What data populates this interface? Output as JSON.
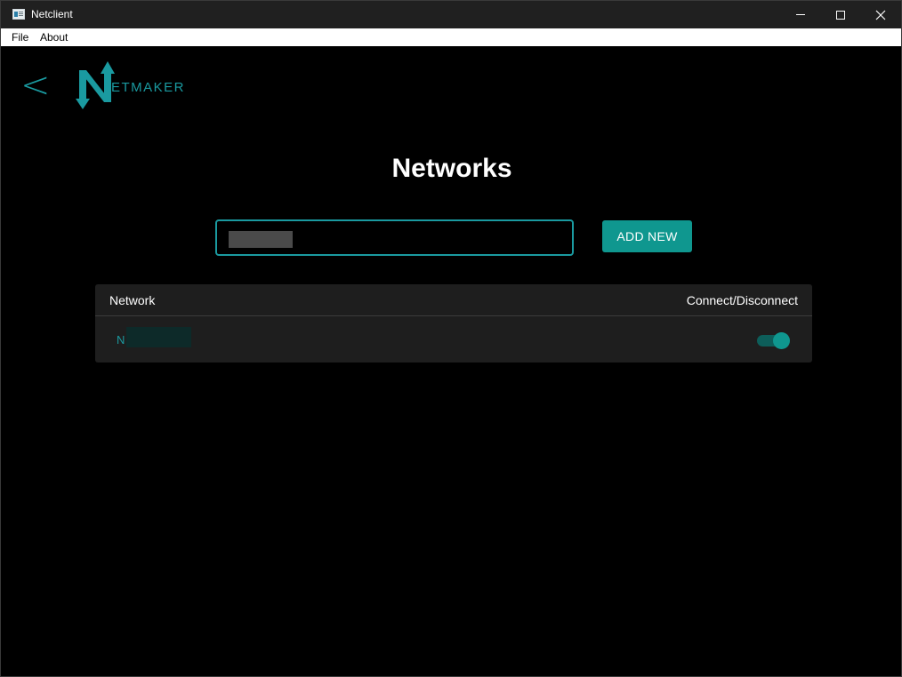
{
  "window": {
    "title": "Netclient"
  },
  "menu": {
    "file": "File",
    "about": "About"
  },
  "header": {
    "back_label": "<",
    "logo_text": "ETMAKER"
  },
  "main": {
    "title": "Networks",
    "search_value": "",
    "add_new_label": "ADD NEW"
  },
  "table": {
    "columns": [
      "Network",
      "Connect/Disconnect"
    ],
    "rows": [
      {
        "network": "N",
        "connected": true
      }
    ]
  },
  "colors": {
    "accent": "#0f978f",
    "logo": "#1a9aa0",
    "background": "#000000",
    "table_bg": "#1e1e1e"
  }
}
